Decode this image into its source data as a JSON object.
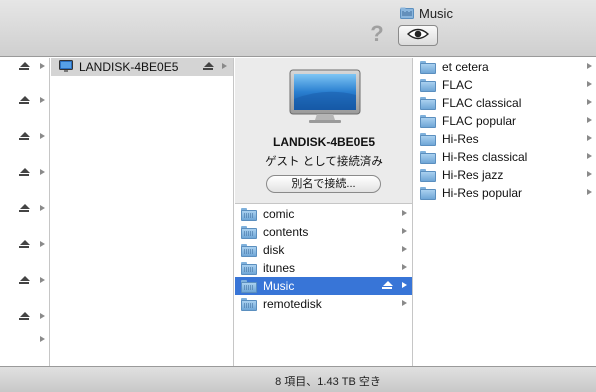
{
  "window": {
    "title": "Music"
  },
  "toolbar": {
    "help_symbol": "?"
  },
  "sidebar_column": {
    "eject_count": 8
  },
  "host_column": {
    "host": {
      "label": "LANDISK-4BE0E5"
    }
  },
  "preview": {
    "name": "LANDISK-4BE0E5",
    "status": "ゲスト として接続済み",
    "connect_button_label": "別名で接続..."
  },
  "shares_column": {
    "items": [
      {
        "label": "comic"
      },
      {
        "label": "contents"
      },
      {
        "label": "disk"
      },
      {
        "label": "itunes"
      },
      {
        "label": "Music"
      },
      {
        "label": "remotedisk"
      }
    ]
  },
  "folders_column": {
    "items": [
      {
        "label": "et cetera"
      },
      {
        "label": "FLAC"
      },
      {
        "label": "FLAC classical"
      },
      {
        "label": "FLAC popular"
      },
      {
        "label": "Hi-Res"
      },
      {
        "label": "Hi-Res classical"
      },
      {
        "label": "Hi-Res jazz"
      },
      {
        "label": "Hi-Res popular"
      }
    ]
  },
  "status": {
    "text": "8 項目、1.43 TB 空き"
  }
}
